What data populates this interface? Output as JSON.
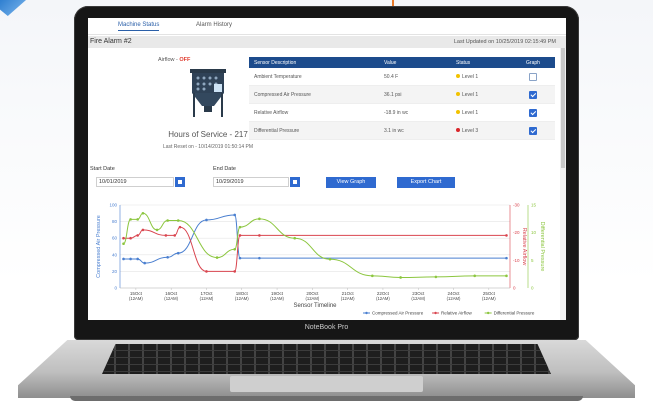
{
  "laptop": {
    "brand": "NoteBook Pro"
  },
  "app": {
    "tabs": [
      "Machine Status",
      "Alarm History"
    ],
    "title": "Fire Alarm #2",
    "last_updated": "Last Updated on 10/25/2019 02:15:49 PM",
    "device": {
      "airflow_label": "Airflow - ",
      "airflow_value": "OFF",
      "hours_of_service": "Hours of Service - 217",
      "last_reset": "Last Reset on - 10/14/2019 01:50:14 PM"
    },
    "sensor_table": {
      "headers": [
        "Sensor Description",
        "Value",
        "Status",
        "Graph"
      ],
      "rows": [
        {
          "description": "Ambient Temperature",
          "value": "50.4 F",
          "status": "Level 1",
          "status_color": "#f2c200",
          "graph": false
        },
        {
          "description": "Compressed Air Pressure",
          "value": "36.1 psi",
          "status": "Level 1",
          "status_color": "#f2c200",
          "graph": true
        },
        {
          "description": "Relative Airflow",
          "value": "-18.9 in wc",
          "status": "Level 1",
          "status_color": "#f2c200",
          "graph": true
        },
        {
          "description": "Differential Pressure",
          "value": "3.1 in wc",
          "status": "Level 3",
          "status_color": "#d9262b",
          "graph": true
        }
      ]
    },
    "controls": {
      "start_date_label": "Start Date",
      "start_date": "10/01/2019",
      "end_date_label": "End Date",
      "end_date": "10/29/2019",
      "view_graph": "View Graph",
      "export_chart": "Export Chart"
    }
  },
  "colors": {
    "primary": "#2f6ad0",
    "header": "#1c4b8c",
    "blue_series": "#4a7fd0",
    "red_series": "#d9454f",
    "green_series": "#8cc63f"
  },
  "chart_data": {
    "type": "line",
    "xlabel": "Sensor Timeline",
    "x_ticks": [
      {
        "day": "15Oct",
        "time": "(12AM)"
      },
      {
        "day": "16Oct",
        "time": "(12AM)"
      },
      {
        "day": "17Oct",
        "time": "(12AM)"
      },
      {
        "day": "18Oct",
        "time": "(12AM)"
      },
      {
        "day": "19Oct",
        "time": "(12AM)"
      },
      {
        "day": "20Oct",
        "time": "(12AM)"
      },
      {
        "day": "21Oct",
        "time": "(12AM)"
      },
      {
        "day": "22Oct",
        "time": "(12AM)"
      },
      {
        "day": "23Oct",
        "time": "(12AM)"
      },
      {
        "day": "24Oct",
        "time": "(12AM)"
      },
      {
        "day": "25Oct",
        "time": "(12AM)"
      }
    ],
    "x_range": [
      14.55,
      25.6
    ],
    "left_axis": {
      "label": "Compressed Air Pressure",
      "ticks": [
        0,
        20,
        40,
        60,
        80,
        100
      ],
      "range": [
        0,
        100
      ]
    },
    "right_axis_1": {
      "label": "Relative Airflow",
      "ticks": [
        0,
        -10,
        -20,
        -30
      ],
      "range": [
        0,
        -30
      ]
    },
    "right_axis_2": {
      "label": "Differential Pressure",
      "ticks": [
        0,
        5,
        10,
        15
      ],
      "range": [
        0,
        15
      ]
    },
    "series": [
      {
        "name": "Compressed Air Pressure",
        "axis": "left",
        "x": [
          14.65,
          14.85,
          15.05,
          15.25,
          15.9,
          16.2,
          17.0,
          17.8,
          17.95,
          18.5,
          25.5
        ],
        "y": [
          35,
          35,
          35,
          30,
          37,
          42,
          82,
          88,
          36,
          36,
          36
        ]
      },
      {
        "name": "Relative Airflow",
        "axis": "right_1",
        "x": [
          14.65,
          14.85,
          15.05,
          15.2,
          15.85,
          16.1,
          16.25,
          17.0,
          17.8,
          17.95,
          18.5,
          25.5
        ],
        "y": [
          -18,
          -18,
          -19,
          -21,
          -19,
          -19,
          -22,
          -6,
          -6,
          -19,
          -19,
          -19
        ]
      },
      {
        "name": "Differential Pressure",
        "axis": "right_2",
        "x": [
          14.65,
          14.85,
          15.05,
          15.2,
          15.6,
          15.9,
          16.2,
          17.3,
          17.8,
          17.95,
          18.5,
          19.5,
          20.5,
          21.7,
          22.5,
          23.5,
          24.6,
          25.5
        ],
        "y": [
          8,
          12.4,
          12.4,
          13.5,
          10.5,
          12.2,
          12.2,
          5.5,
          7,
          11,
          12.5,
          9,
          5.2,
          2.2,
          1.9,
          2.0,
          2.2,
          2.2
        ]
      }
    ],
    "legend": [
      "Compressed Air Pressure",
      "Relative Airflow",
      "Differential Pressure"
    ],
    "legend_position": "bottom-right"
  }
}
